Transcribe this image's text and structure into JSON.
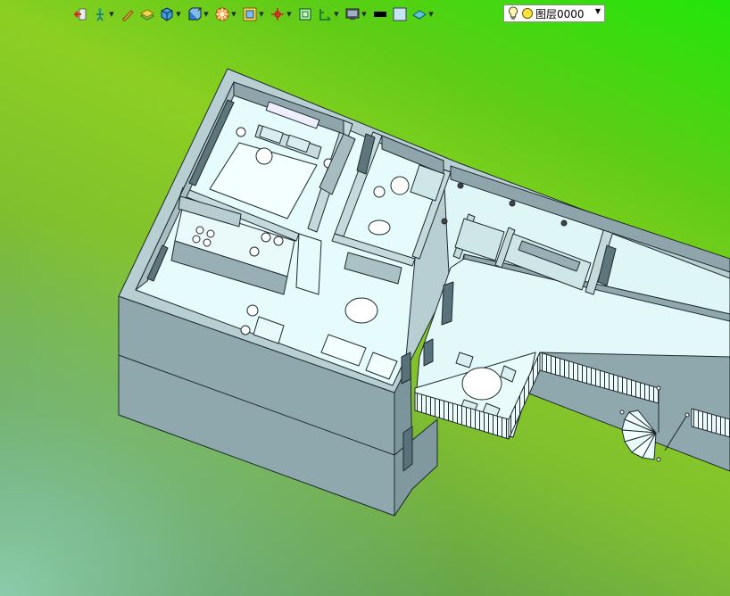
{
  "toolbar": {
    "buttons": [
      {
        "name": "exit-icon",
        "dropdown": false
      },
      {
        "name": "figure-icon",
        "dropdown": true
      },
      {
        "name": "pencil-icon",
        "dropdown": false
      },
      {
        "name": "layer-stack-icon",
        "dropdown": false
      },
      {
        "name": "cube-icon",
        "dropdown": true
      },
      {
        "name": "box-view-icon",
        "dropdown": true
      },
      {
        "name": "orbit-wheel-icon",
        "dropdown": true
      },
      {
        "name": "zoom-frame-icon",
        "dropdown": true
      },
      {
        "name": "axis-cross-icon",
        "dropdown": true
      },
      {
        "name": "rectangle-select-icon",
        "dropdown": false
      },
      {
        "name": "dimension-icon",
        "dropdown": true
      },
      {
        "name": "monitor-icon",
        "dropdown": true
      },
      {
        "name": "line-weight-icon",
        "dropdown": false
      },
      {
        "name": "fill-color-icon",
        "dropdown": false
      },
      {
        "name": "plane-icon",
        "dropdown": true
      }
    ],
    "layer": {
      "label": "图层0000",
      "bulb_icon": "lightbulb-icon",
      "state_icon": "sun-icon"
    }
  },
  "viewport": {
    "background_top": "#22e60a",
    "background_bottom": "#4f8a3e",
    "model_face_color": "#e6fbfb",
    "model_wall_color": "#8ea6ad",
    "model_edge_color": "#1e2a2d"
  }
}
